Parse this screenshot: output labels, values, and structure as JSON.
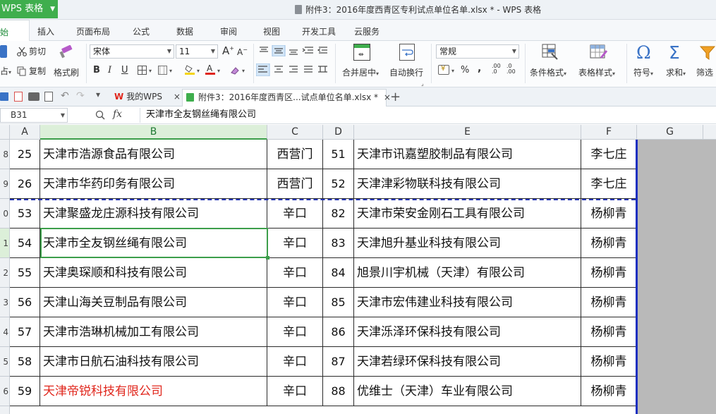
{
  "app": {
    "name": "WPS 表格",
    "window_title": "附件3：2016年度西青区专利试点单位名单.xlsx * - WPS 表格"
  },
  "menu": {
    "tabs": [
      "开始",
      "插入",
      "页面布局",
      "公式",
      "数据",
      "审阅",
      "视图",
      "开发工具",
      "云服务"
    ]
  },
  "ribbon": {
    "cut": "剪切",
    "copy": "复制",
    "format_painter": "格式刷",
    "paste_suffix": "占",
    "font_name": "宋体",
    "font_size": "11",
    "merge_center": "合并居中",
    "wrap_text": "自动换行",
    "number_format": "常规",
    "conditional_format": "条件格式",
    "table_style": "表格样式",
    "symbol": "符号",
    "sum": "求和",
    "filter": "筛选",
    "bold": "B",
    "italic": "I",
    "underline": "U",
    "font_grow": "A",
    "font_shrink": "A",
    "percent": "%",
    "comma": ",",
    "dec_inc": ".00 .0",
    "dec_dec": ".0 .00",
    "symbol_glyph": "Ω",
    "sum_glyph": "Σ"
  },
  "doc_tabs": {
    "my_wps": "我的WPS",
    "active_doc": "附件3：2016年度西青区...试点单位名单.xlsx *",
    "close": "×",
    "new_tab": "+"
  },
  "formula_bar": {
    "cell_ref": "B31",
    "fx": "fx",
    "content": "天津市全友钢丝绳有限公司"
  },
  "columns": [
    "A",
    "B",
    "C",
    "D",
    "E",
    "F",
    "G"
  ],
  "row_numbers": [
    "8",
    "9",
    "0",
    "1",
    "2",
    "3",
    "4",
    "5",
    "6"
  ],
  "rows": [
    {
      "a": "25",
      "b": "天津市浩源食品有限公司",
      "c": "西营门",
      "d": "51",
      "e": "天津市讯嘉塑胶制品有限公司",
      "f": "李七庄"
    },
    {
      "a": "26",
      "b": "天津市华药印务有限公司",
      "c": "西营门",
      "d": "52",
      "e": "天津津彩物联科技有限公司",
      "f": "李七庄"
    },
    {
      "a": "53",
      "b": "天津聚盛龙庄源科技有限公司",
      "c": "辛口",
      "d": "82",
      "e": "天津市荣安金刚石工具有限公司",
      "f": "杨柳青"
    },
    {
      "a": "54",
      "b": "天津市全友钢丝绳有限公司",
      "c": "辛口",
      "d": "83",
      "e": "天津旭升基业科技有限公司",
      "f": "杨柳青"
    },
    {
      "a": "55",
      "b": "天津奥琛顺和科技有限公司",
      "c": "辛口",
      "d": "84",
      "e": "旭景川宇机械（天津）有限公司",
      "f": "杨柳青"
    },
    {
      "a": "56",
      "b": "天津山海关豆制品有限公司",
      "c": "辛口",
      "d": "85",
      "e": "天津市宏伟建业科技有限公司",
      "f": "杨柳青"
    },
    {
      "a": "57",
      "b": "天津市浩琳机械加工有限公司",
      "c": "辛口",
      "d": "86",
      "e": "天津泺泽环保科技有限公司",
      "f": "杨柳青"
    },
    {
      "a": "58",
      "b": "天津市日航石油科技有限公司",
      "c": "辛口",
      "d": "87",
      "e": "天津若绿环保科技有限公司",
      "f": "杨柳青"
    },
    {
      "a": "59",
      "b": "天津帝锐科技有限公司",
      "c": "辛口",
      "d": "88",
      "e": "优维士（天津）车业有限公司",
      "f": "杨柳青",
      "b_color": "#e0251b"
    }
  ]
}
